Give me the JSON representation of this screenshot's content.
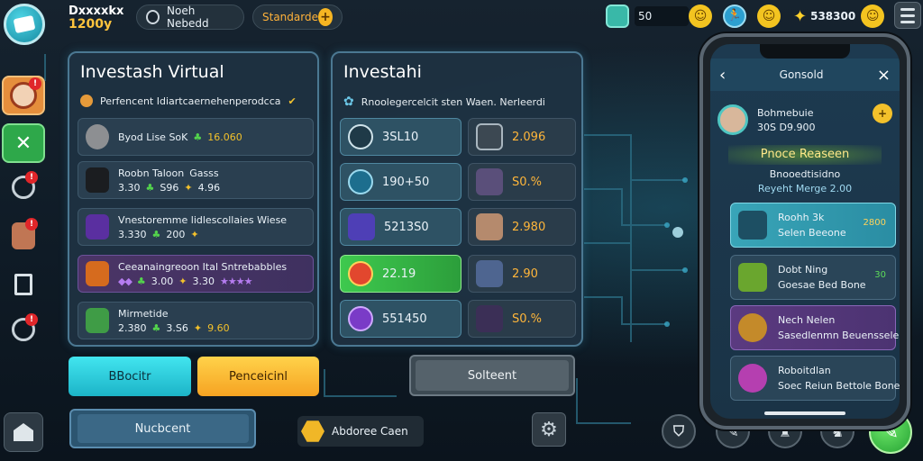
{
  "topbar": {
    "player_name_line1": "Dxxxxkx",
    "player_name_line2": "1200y",
    "server_label": "Noeh Nebedd",
    "standard_label": "Standarde",
    "resource_a_value": "50",
    "resource_e_value": "538300"
  },
  "left_panel": {
    "title": "Investash Virtual",
    "subtitle": "Perfencent Idiartcaernehenperodcca",
    "rows": [
      {
        "name": "Byod Lise SoK",
        "stat1": "16.060",
        "stat2": ""
      },
      {
        "name": "Roobn Taloon",
        "tag": "Gasss",
        "stat1": "3.30",
        "stat2": "S96",
        "stat3": "4.96"
      },
      {
        "name": "Vnestoremme lidlescollaies Wiese",
        "stat1": "3.330",
        "stat2": "200",
        "stat3": ""
      },
      {
        "name": "Ceeanaingreoon Ital Sntrebabbles",
        "stat1": "3.00",
        "stat2": "3.30"
      },
      {
        "name": "Mirmetide",
        "stat1": "2.380",
        "stat2": "3.S6",
        "stat3": "9.60"
      }
    ]
  },
  "mid_panel": {
    "title": "Investahi",
    "subtitle": "Rnoolegercelcit sten Waen. Nerleerdi",
    "left_tiles": [
      "3SL10",
      "190+50",
      "5213S0",
      "22.19",
      "551450"
    ],
    "right_tiles": [
      "2.096",
      "S0.%",
      "2.980",
      "2.90",
      "S0.%"
    ]
  },
  "buttons": {
    "cyan": "BBocitr",
    "orange": "Penceicinl",
    "dark": "Solteent",
    "blue": "Nucbcent",
    "chip": "Abdoree Caen"
  },
  "phone": {
    "header_title": "Gonsold",
    "profile_name": "Bohmebuie",
    "profile_value": "30S D9.900",
    "banner": "Pnoce Reaseen",
    "line1": "Bnooedtisidno",
    "line2": "Reyeht Merge 2.00",
    "cards": [
      {
        "title": "Roohh 3k",
        "sub": "Selen Beeone",
        "value": "2800"
      },
      {
        "title": "Dobt Ning",
        "sub": "Goesae Bed Bone",
        "value": "30"
      },
      {
        "title": "Nech Nelen",
        "sub": "Sasedlenmn Beuenssele",
        "value": ""
      },
      {
        "title": "Roboitdlan",
        "sub": "Soec Reiun Bettole Bone",
        "value": ""
      }
    ]
  },
  "colors": {
    "accent_cyan": "#42e5ef",
    "accent_orange": "#f6a322",
    "accent_green": "#3ec94e",
    "panel_border": "#4b7892"
  }
}
